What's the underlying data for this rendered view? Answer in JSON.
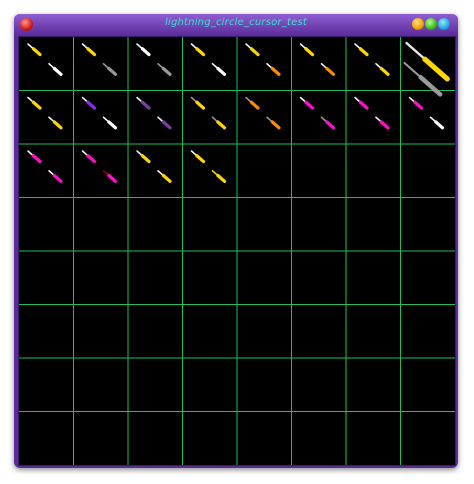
{
  "window": {
    "title": "lightning_circle_cursor_test"
  },
  "grid": {
    "rows": 8,
    "columns": 8,
    "line_color": "#1fbf5c",
    "background": "#000000"
  },
  "colors": {
    "white": "#ffffff",
    "yellow": "#ffd700",
    "grey": "#9a9a9a",
    "orange": "#ff8c00",
    "magenta": "#ff10c8",
    "purple": "#8a2be2",
    "darkpurple": "#7a3fa0",
    "darkred": "#8b0000",
    "light": "#e8e8e8"
  },
  "cursors": [
    {
      "tip": "white",
      "handle": "yellow",
      "tail": "white",
      "tail_handle": "white"
    },
    {
      "tip": "white",
      "handle": "yellow",
      "tail": "grey",
      "tail_handle": "grey"
    },
    {
      "tip": "white",
      "handle": "white",
      "tail": "grey",
      "tail_handle": "grey"
    },
    {
      "tip": "white",
      "handle": "yellow",
      "tail": "white",
      "tail_handle": "white"
    },
    {
      "tip": "white",
      "handle": "yellow",
      "tail": "white",
      "tail_handle": "orange"
    },
    {
      "tip": "white",
      "handle": "yellow",
      "tail": "white",
      "tail_handle": "orange"
    },
    {
      "tip": "white",
      "handle": "yellow",
      "tail": "white",
      "tail_handle": "yellow"
    },
    {
      "tip": "light",
      "handle": "light",
      "tail": "grey",
      "tail_handle": "grey",
      "large": true
    },
    {
      "tip": "white",
      "handle": "yellow",
      "tail": "white",
      "tail_handle": "yellow"
    },
    {
      "tip": "white",
      "handle": "purple",
      "tail": "white",
      "tail_handle": "white"
    },
    {
      "tip": "white",
      "handle": "darkpurple",
      "tail": "white",
      "tail_handle": "darkpurple"
    },
    {
      "tip": "grey",
      "handle": "yellow",
      "tail": "grey",
      "tail_handle": "yellow"
    },
    {
      "tip": "grey",
      "handle": "orange",
      "tail": "grey",
      "tail_handle": "orange"
    },
    {
      "tip": "white",
      "handle": "magenta",
      "tail": "grey",
      "tail_handle": "magenta"
    },
    {
      "tip": "white",
      "handle": "magenta",
      "tail": "white",
      "tail_handle": "magenta"
    },
    {
      "tip": "white",
      "handle": "magenta",
      "tail": "white",
      "tail_handle": "white"
    },
    {
      "tip": "white",
      "handle": "magenta",
      "tail": "white",
      "tail_handle": "magenta"
    },
    {
      "tip": "white",
      "handle": "magenta",
      "tail": "darkred",
      "tail_handle": "magenta"
    },
    {
      "tip": "white",
      "handle": "yellow",
      "tail": "white",
      "tail_handle": "yellow"
    },
    {
      "tip": "white",
      "handle": "yellow",
      "tail": "yellow",
      "tail_handle": "yellow"
    }
  ]
}
